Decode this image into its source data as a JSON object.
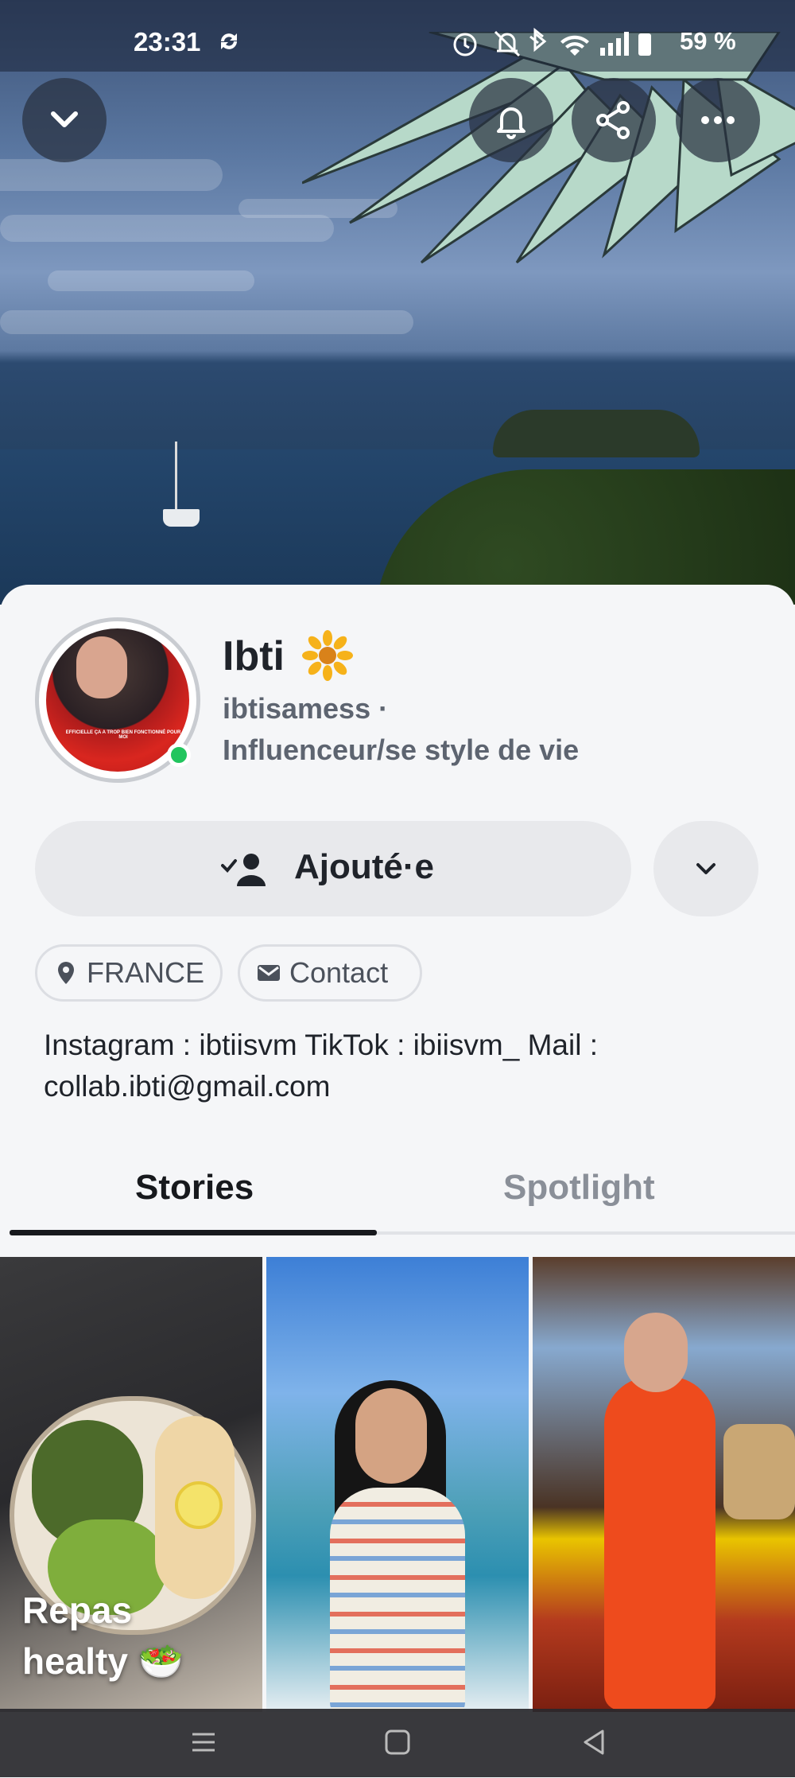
{
  "status_bar": {
    "time": "23:31",
    "battery": "59 %"
  },
  "cover_actions": {
    "collapse_icon": "chevron-down-icon",
    "bell_icon": "bell-icon",
    "share_icon": "share-icon",
    "more_icon": "more-dots-icon"
  },
  "profile": {
    "display_name": "Ibti",
    "name_emoji": "sunflower",
    "username": "ibtisamess ·",
    "category": "Influenceur/se style de vie",
    "online": true,
    "avatar_caption": "EFFICIELLE ÇA A TROP BIEN FONCTIONNÉ POUR MOI"
  },
  "actions": {
    "added_label": "Ajouté·e"
  },
  "chips": {
    "location": "FRANCE",
    "contact": "Contact"
  },
  "bio": "Instagram : ibtiisvm  TikTok : ibiisvm_ Mail : collab.ibti@gmail.com",
  "tabs": {
    "stories": "Stories",
    "spotlight": "Spotlight",
    "active": "stories"
  },
  "stories": {
    "tile_1_caption_line1": "Repas",
    "tile_1_caption_line2": "healty 🥗"
  },
  "colors": {
    "online": "#22c55e",
    "text_primary": "#1f232a",
    "text_secondary": "#5d6470"
  }
}
